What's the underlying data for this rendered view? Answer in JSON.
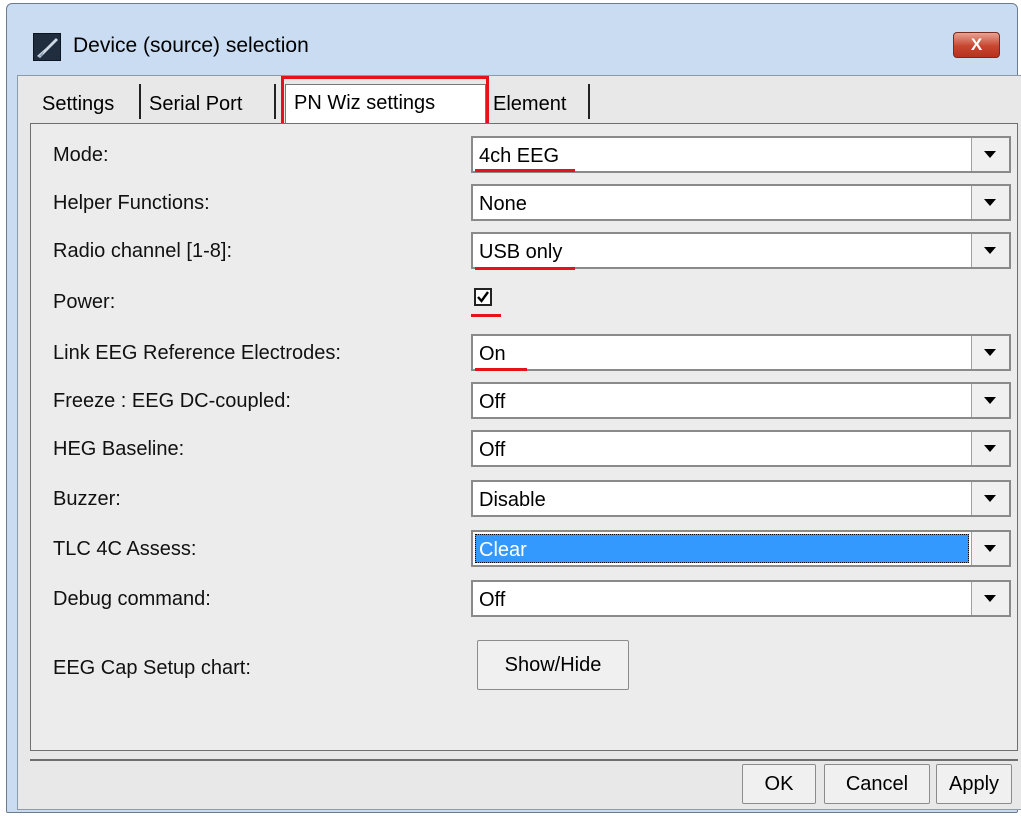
{
  "window": {
    "title": "Device (source) selection",
    "close_glyph": "X",
    "icon": "app-logo-icon"
  },
  "tabs": [
    {
      "label": "Settings",
      "active": false
    },
    {
      "label": "Serial Port",
      "active": false
    },
    {
      "label": "PN Wiz settings",
      "active": true
    },
    {
      "label": "Element",
      "active": false
    }
  ],
  "fields": [
    {
      "label": "Mode:",
      "value": "4ch EEG",
      "type": "select"
    },
    {
      "label": "Helper Functions:",
      "value": "None",
      "type": "select"
    },
    {
      "label": "Radio channel [1-8]:",
      "value": "USB only",
      "type": "select"
    },
    {
      "label": "Power:",
      "checked": true,
      "type": "checkbox"
    },
    {
      "label": "Link EEG Reference Electrodes:",
      "value": "On",
      "type": "select"
    },
    {
      "label": "Freeze : EEG DC-coupled:",
      "value": "Off",
      "type": "select"
    },
    {
      "label": "HEG Baseline:",
      "value": "Off",
      "type": "select"
    },
    {
      "label": "Buzzer:",
      "value": "Disable",
      "type": "select"
    },
    {
      "label": "TLC 4C Assess:",
      "value": "Clear",
      "type": "select",
      "focused": true
    },
    {
      "label": "Debug command:",
      "value": "Off",
      "type": "select"
    },
    {
      "label": "EEG Cap Setup chart:",
      "button": "Show/Hide",
      "type": "button"
    }
  ],
  "footer": {
    "ok": "OK",
    "cancel": "Cancel",
    "apply": "Apply"
  },
  "colors": {
    "annotation_red": "#e8101a",
    "selection_blue": "#3399ff"
  }
}
